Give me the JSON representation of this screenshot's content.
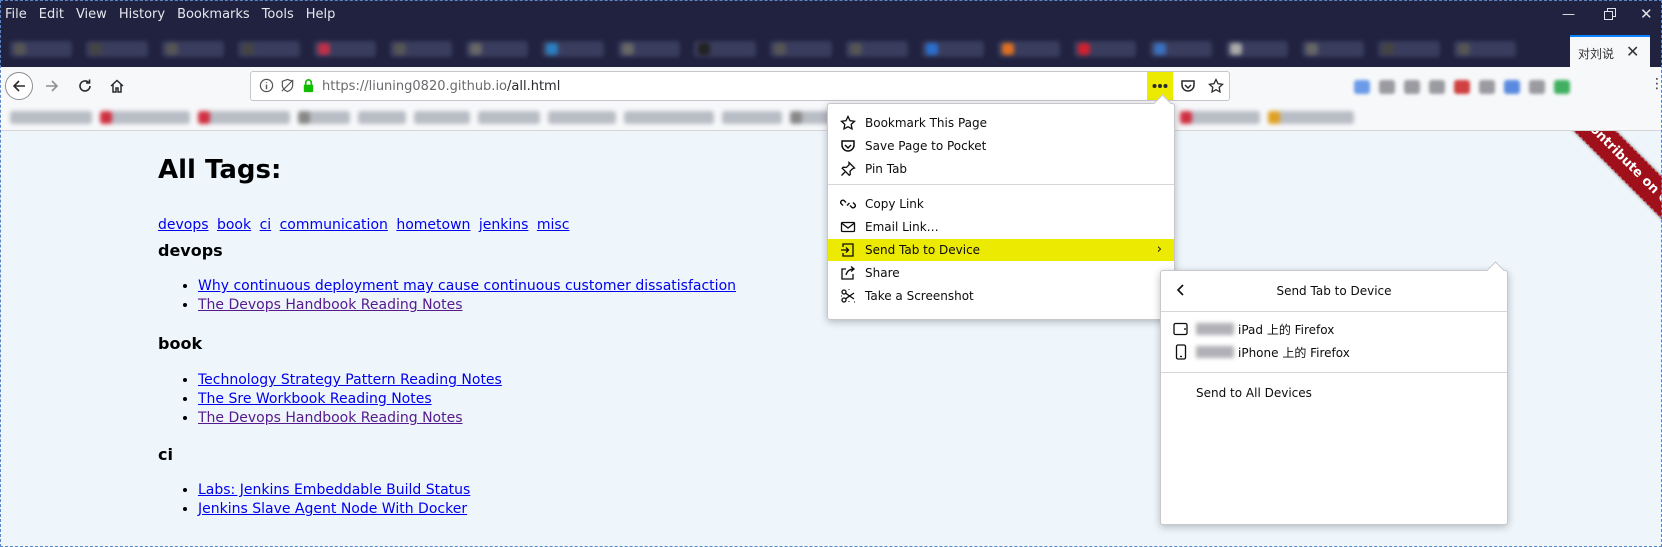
{
  "menubar": {
    "items": [
      "File",
      "Edit",
      "View",
      "History",
      "Bookmarks",
      "Tools",
      "Help"
    ]
  },
  "tabs": {
    "active_tab_title": "对刘说",
    "blurred_tab_count": 20,
    "favicon_colors": [
      "#555",
      "#444",
      "#555",
      "#444",
      "#c0304a",
      "#555",
      "#666",
      "#2a7fc0",
      "#666",
      "#222",
      "#555",
      "#555",
      "#2a6fd0",
      "#e07020",
      "#d02030",
      "#3a70c0",
      "#aaaaaa",
      "#666",
      "#444",
      "#555"
    ]
  },
  "navbar": {
    "url_host": "https://liuning0820.github.io",
    "url_path": "/all.html",
    "page_actions": [
      "more-actions-icon",
      "pocket-icon",
      "bookmark-star-icon"
    ]
  },
  "toolbar_blur_colors": [
    "#6b9be8",
    "#9a9aa0",
    "#9a9aa0",
    "#9a9aa0",
    "#d04040",
    "#9a9aa0",
    "#5a8ae0",
    "#9a9aa0",
    "#40b060"
  ],
  "bookmarks_bar": {
    "entries": [
      {
        "width": 82,
        "dot": ""
      },
      {
        "width": 90,
        "dot": "#d03040"
      },
      {
        "width": 92,
        "dot": "#d03040"
      },
      {
        "width": 52,
        "dot": "#888"
      },
      {
        "width": 48,
        "dot": ""
      },
      {
        "width": 56,
        "dot": ""
      },
      {
        "width": 62,
        "dot": ""
      },
      {
        "width": 68,
        "dot": ""
      },
      {
        "width": 90,
        "dot": ""
      },
      {
        "width": 60,
        "dot": ""
      },
      {
        "width": 130,
        "dot": "#888"
      },
      {
        "width": 80,
        "dot": "#d03040"
      },
      {
        "width": 86,
        "dot": "#e0a020"
      }
    ]
  },
  "page": {
    "heading": "All Tags:",
    "tags": [
      "devops",
      "book",
      "ci",
      "communication",
      "hometown",
      "jenkins",
      "misc"
    ],
    "sections": [
      {
        "title": "devops",
        "links": [
          {
            "text": "Why continuous deployment may cause continuous customer dissatisfaction",
            "visited": false
          },
          {
            "text": "The Devops Handbook Reading Notes",
            "visited": true
          }
        ]
      },
      {
        "title": "book",
        "links": [
          {
            "text": "Technology Strategy Pattern Reading Notes",
            "visited": false
          },
          {
            "text": "The Sre Workbook Reading Notes",
            "visited": false
          },
          {
            "text": "The Devops Handbook Reading Notes",
            "visited": true
          }
        ]
      },
      {
        "title": "ci",
        "links": [
          {
            "text": "Labs: Jenkins Embeddable Build Status",
            "visited": false
          },
          {
            "text": "Jenkins Slave Agent Node With Docker",
            "visited": false
          }
        ]
      }
    ],
    "ribbon": "Contribute on GitHub"
  },
  "page_action_panel": {
    "items": [
      {
        "label": "Bookmark This Page",
        "icon": "star-icon"
      },
      {
        "label": "Save Page to Pocket",
        "icon": "pocket-icon"
      },
      {
        "label": "Pin Tab",
        "icon": "pin-icon"
      },
      {
        "label": "Copy Link",
        "icon": "link-icon"
      },
      {
        "label": "Email Link…",
        "icon": "email-icon"
      },
      {
        "label": "Send Tab to Device",
        "icon": "send-tab-icon",
        "highlighted": true,
        "submenu": true
      },
      {
        "label": "Share",
        "icon": "share-icon"
      },
      {
        "label": "Take a Screenshot",
        "icon": "screenshot-icon"
      }
    ]
  },
  "send_tab_panel": {
    "title": "Send Tab to Device",
    "devices": [
      {
        "label": "iPad 上的 Firefox",
        "icon": "tablet-icon"
      },
      {
        "label": "iPhone 上的 Firefox",
        "icon": "phone-icon"
      }
    ],
    "send_all": "Send to All Devices"
  },
  "colors": {
    "chrome_dark": "#20223f",
    "highlight": "#ecea00",
    "link": "#0000ee",
    "visited_link": "#551a8b",
    "page_bg": "#eef6fc",
    "ribbon": "#a0101a"
  }
}
